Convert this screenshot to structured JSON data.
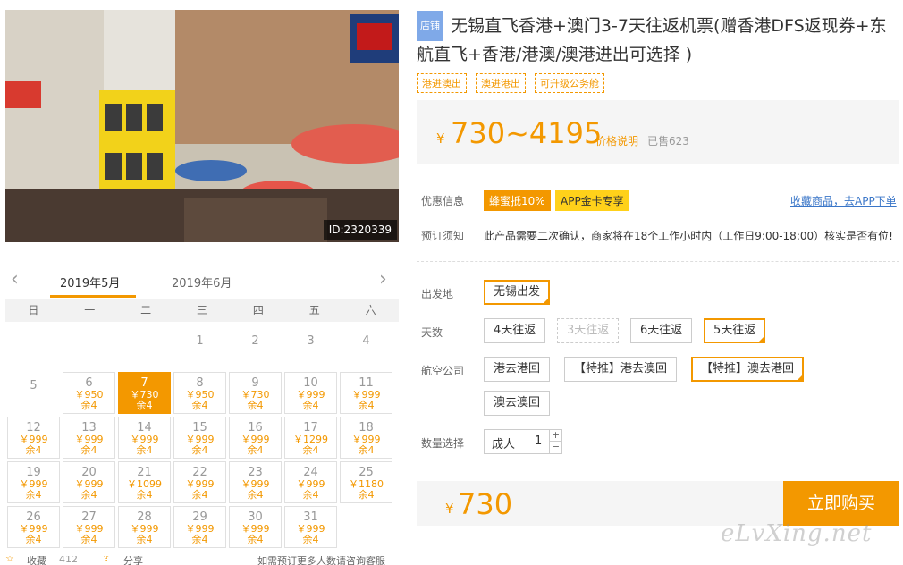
{
  "photo": {
    "id_label": "ID:2320339"
  },
  "calendar": {
    "months": [
      "2019年5月",
      "2019年6月"
    ],
    "weekdays": [
      "日",
      "一",
      "二",
      "三",
      "四",
      "五",
      "六"
    ],
    "rows": [
      [
        {
          "d": ""
        },
        {
          "d": ""
        },
        {
          "d": ""
        },
        {
          "d": "1"
        },
        {
          "d": "2"
        },
        {
          "d": "3"
        },
        {
          "d": "4"
        }
      ],
      [
        {
          "d": "5"
        },
        {
          "d": "6",
          "p": "￥950",
          "r": "余4"
        },
        {
          "d": "7",
          "p": "￥730",
          "r": "余4",
          "sel": true
        },
        {
          "d": "8",
          "p": "￥950",
          "r": "余4"
        },
        {
          "d": "9",
          "p": "￥730",
          "r": "余4"
        },
        {
          "d": "10",
          "p": "￥999",
          "r": "余4"
        },
        {
          "d": "11",
          "p": "￥999",
          "r": "余4"
        }
      ],
      [
        {
          "d": "12",
          "p": "￥999",
          "r": "余4"
        },
        {
          "d": "13",
          "p": "￥999",
          "r": "余4"
        },
        {
          "d": "14",
          "p": "￥999",
          "r": "余4"
        },
        {
          "d": "15",
          "p": "￥999",
          "r": "余4"
        },
        {
          "d": "16",
          "p": "￥999",
          "r": "余4"
        },
        {
          "d": "17",
          "p": "￥1299",
          "r": "余4"
        },
        {
          "d": "18",
          "p": "￥999",
          "r": "余4"
        }
      ],
      [
        {
          "d": "19",
          "p": "￥999",
          "r": "余4"
        },
        {
          "d": "20",
          "p": "￥999",
          "r": "余4"
        },
        {
          "d": "21",
          "p": "￥1099",
          "r": "余4"
        },
        {
          "d": "22",
          "p": "￥999",
          "r": "余4"
        },
        {
          "d": "23",
          "p": "￥999",
          "r": "余4"
        },
        {
          "d": "24",
          "p": "￥999",
          "r": "余4"
        },
        {
          "d": "25",
          "p": "￥1180",
          "r": "余4"
        }
      ],
      [
        {
          "d": "26",
          "p": "￥999",
          "r": "余4"
        },
        {
          "d": "27",
          "p": "￥999",
          "r": "余4"
        },
        {
          "d": "28",
          "p": "￥999",
          "r": "余4"
        },
        {
          "d": "29",
          "p": "￥999",
          "r": "余4"
        },
        {
          "d": "30",
          "p": "￥999",
          "r": "余4"
        },
        {
          "d": "31",
          "p": "￥999",
          "r": "余4"
        },
        {
          "d": ""
        }
      ]
    ]
  },
  "bottom": {
    "collect": "收藏",
    "collect_count": "412",
    "share": "分享",
    "consult": "如需预订更多人数请咨询客服"
  },
  "product": {
    "shop_tag": "店铺",
    "title": "无锡直飞香港+澳门3-7天往返机票(赠香港DFS返现券+东航直飞+香港/港澳/澳港进出可选择 )",
    "tags": [
      "港进澳出",
      "澳进港出",
      "可升级公务舱"
    ],
    "price_yen": "¥",
    "price_range": "730~4195",
    "price_explain": "价格说明",
    "sold": "已售623"
  },
  "promo": {
    "label": "优惠信息",
    "badge1": "蜂蜜抵10%",
    "badge2": "APP金卡专享",
    "fav_link": "收藏商品，去APP下单"
  },
  "notice": {
    "label": "预订须知",
    "text": "此产品需要二次确认，商家将在18个工作小时内（工作日9:00-18:00）核实是否有位!"
  },
  "options": {
    "departure_label": "出发地",
    "departure": "无锡出发",
    "days_label": "天数",
    "days": [
      "4天往返",
      "3天往返",
      "6天往返",
      "5天往返"
    ],
    "airline_label": "航空公司",
    "airlines": [
      "港去港回",
      "【特推】港去澳回",
      "【特推】澳去港回",
      "澳去澳回"
    ],
    "qty_label": "数量选择",
    "qty_type": "成人",
    "qty_value": "1",
    "qty_plus": "+",
    "qty_minus": "−"
  },
  "buy": {
    "yen": "¥",
    "price": "730",
    "button": "立即购买"
  },
  "watermark": "eLvXing.net"
}
